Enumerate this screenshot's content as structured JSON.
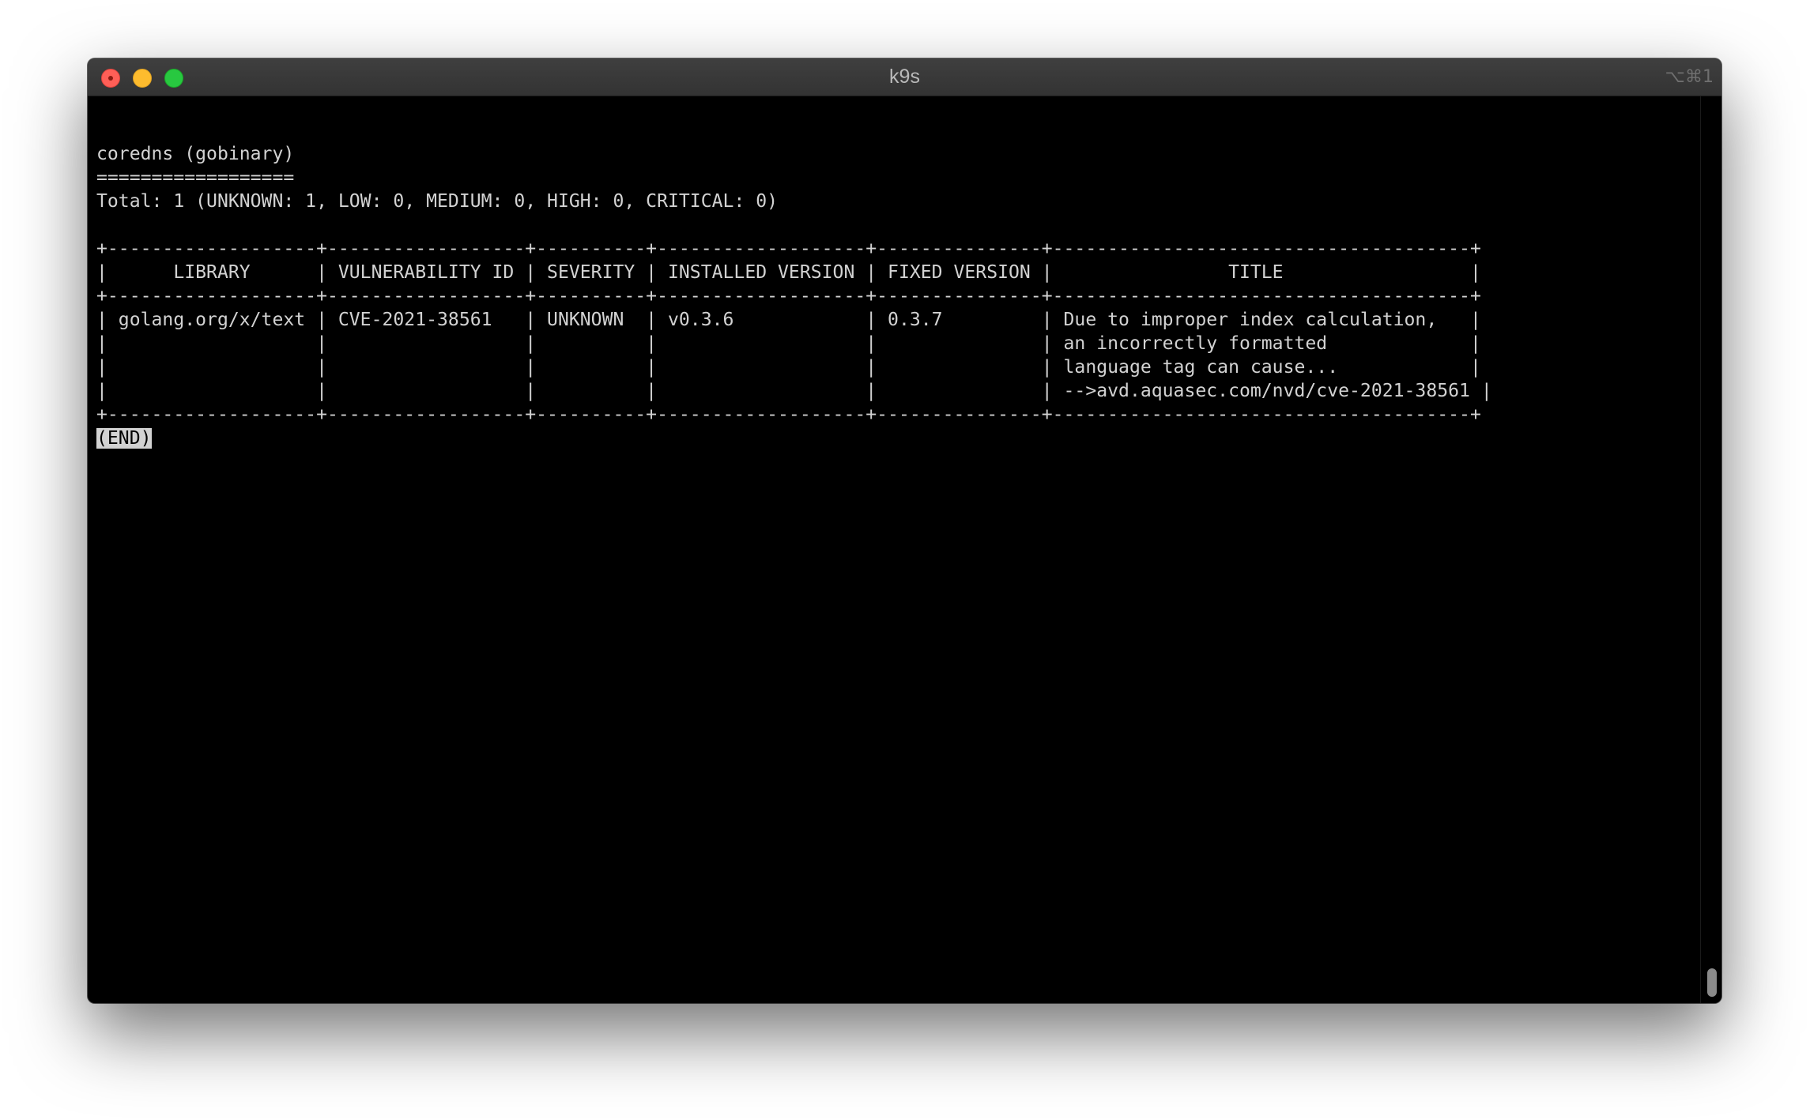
{
  "window": {
    "title": "k9s",
    "shortcut": "⌥⌘1"
  },
  "terminal": {
    "lines": [
      "",
      "coredns (gobinary)",
      "==================",
      "Total: 1 (UNKNOWN: 1, LOW: 0, MEDIUM: 0, HIGH: 0, CRITICAL: 0)",
      "",
      "+-------------------+------------------+----------+-------------------+---------------+--------------------------------------+",
      "|      LIBRARY      | VULNERABILITY ID | SEVERITY | INSTALLED VERSION | FIXED VERSION |                TITLE                 |",
      "+-------------------+------------------+----------+-------------------+---------------+--------------------------------------+",
      "| golang.org/x/text | CVE-2021-38561   | UNKNOWN  | v0.3.6            | 0.3.7         | Due to improper index calculation,   |",
      "|                   |                  |          |                   |               | an incorrectly formatted             |",
      "|                   |                  |          |                   |               | language tag can cause...            |",
      "|                   |                  |          |                   |               | -->avd.aquasec.com/nvd/cve-2021-38561 |",
      "+-------------------+------------------+----------+-------------------+---------------+--------------------------------------+"
    ],
    "end_marker": "(END)"
  },
  "colors": {
    "terminal_bg": "#000000",
    "terminal_fg": "#d2d2d2",
    "titlebar_bg": "#3a3a3a",
    "close": "#ff5f57",
    "minimize": "#febc2e",
    "maximize": "#28c840"
  }
}
